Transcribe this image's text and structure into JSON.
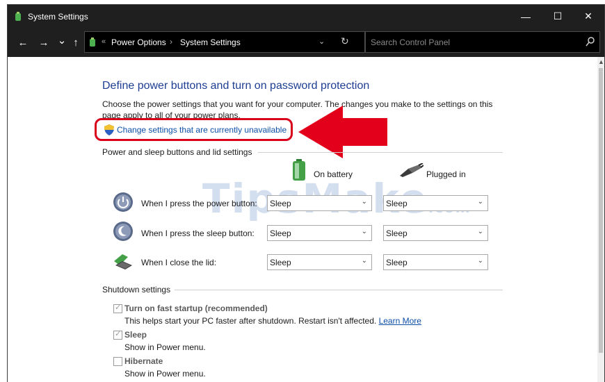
{
  "window": {
    "title": "System Settings",
    "minimize": "—",
    "maximize": "☐",
    "close": "✕"
  },
  "nav": {
    "back": "←",
    "forward": "→",
    "recent": "⌄",
    "up": "↑"
  },
  "address": {
    "overflow": "«",
    "crumbs": [
      "Power Options",
      "System Settings"
    ],
    "separator": "›",
    "dropdown": "⌄",
    "refresh": "↻"
  },
  "search": {
    "placeholder": "Search Control Panel"
  },
  "page": {
    "heading": "Define power buttons and turn on password protection",
    "description": "Choose the power settings that you want for your computer. The changes you make to the settings on this page apply to all of your power plans.",
    "change_link": "Change settings that are currently unavailable"
  },
  "power_section": {
    "label": "Power and sleep buttons and lid settings",
    "columns": [
      "On battery",
      "Plugged in"
    ],
    "rows": [
      {
        "label": "When I press the power button:",
        "on_battery": "Sleep",
        "plugged_in": "Sleep"
      },
      {
        "label": "When I press the sleep button:",
        "on_battery": "Sleep",
        "plugged_in": "Sleep"
      },
      {
        "label": "When I close the lid:",
        "on_battery": "Sleep",
        "plugged_in": "Sleep"
      }
    ]
  },
  "shutdown_section": {
    "label": "Shutdown settings",
    "options": [
      {
        "title": "Turn on fast startup (recommended)",
        "desc": "This helps start your PC faster after shutdown. Restart isn't affected.",
        "link": "Learn More",
        "checked": true
      },
      {
        "title": "Sleep",
        "desc": "Show in Power menu.",
        "checked": true
      },
      {
        "title": "Hibernate",
        "desc": "Show in Power menu.",
        "checked": false
      }
    ]
  },
  "watermark": {
    "text": "TipsMake",
    "suffix": ".com"
  },
  "colors": {
    "titlebar": "#1f1f1f",
    "heading": "#1e3e93",
    "link": "#0d4fa8",
    "highlight": "#d9001b"
  },
  "icons": {
    "app": "control-panel-icon",
    "shield": "uac-shield-icon",
    "battery": "battery-icon",
    "plug": "plug-icon",
    "power": "power-button-icon",
    "sleep": "sleep-button-icon",
    "lid": "laptop-lid-icon",
    "search": "search-icon"
  }
}
